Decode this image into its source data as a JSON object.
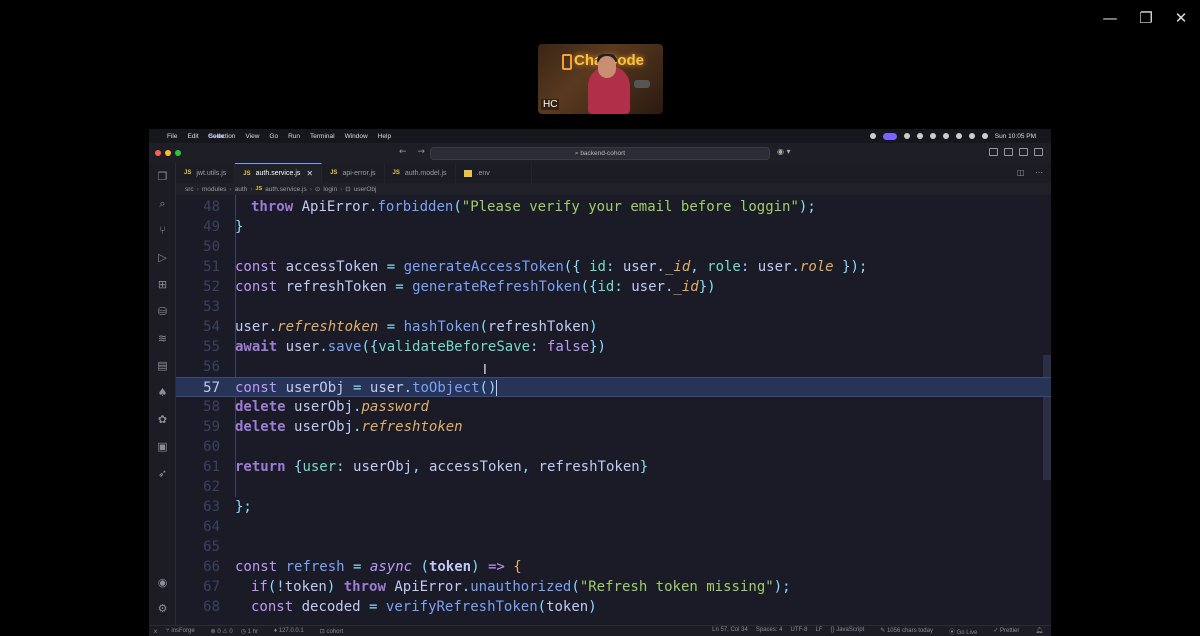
{
  "window_controls": {
    "minimize": "—",
    "restore": "❐",
    "close": "✕"
  },
  "webcam": {
    "logo": "ChaiCode",
    "initials": "HC"
  },
  "menubar": {
    "apple": "",
    "app": "Code",
    "items": [
      "File",
      "Edit",
      "Selection",
      "View",
      "Go",
      "Run",
      "Terminal",
      "Window",
      "Help"
    ],
    "clock": "Sun 10:05 PM"
  },
  "titlebar": {
    "search": "backend-cohort",
    "back": "←",
    "forward": "→"
  },
  "tabs": [
    {
      "label": "jwt.utils.js",
      "type": "JS"
    },
    {
      "label": "auth.service.js",
      "type": "JS",
      "active": true
    },
    {
      "label": "api-error.js",
      "type": "JS"
    },
    {
      "label": "auth.model.js",
      "type": "JS"
    },
    {
      "label": ".env",
      "type": "env"
    }
  ],
  "breadcrumb": {
    "parts": [
      "src",
      "modules",
      "auth"
    ],
    "file": "auth.service.js",
    "func": "login",
    "symbol": "userObj",
    "js": "JS"
  },
  "editor": {
    "current_line": 57,
    "line_numbers": [
      "48",
      "49",
      "50",
      "51",
      "52",
      "53",
      "54",
      "55",
      "56",
      "57",
      "58",
      "59",
      "60",
      "61",
      "62",
      "63",
      "64",
      "65",
      "66",
      "67",
      "68"
    ]
  },
  "statusbar": {
    "branch": "insForge",
    "problems": "⊗ 0 ⚠ 0",
    "time": "1 hr",
    "host": "127.0.0.1",
    "project": "cohort",
    "position": "Ln 57, Col 34",
    "spaces": "Spaces: 4",
    "encoding": "UTF-8",
    "eol": "LF",
    "language": "JavaScript",
    "chars": "1056 chars today",
    "golive": "Go Live",
    "prettier": "Prettier"
  }
}
